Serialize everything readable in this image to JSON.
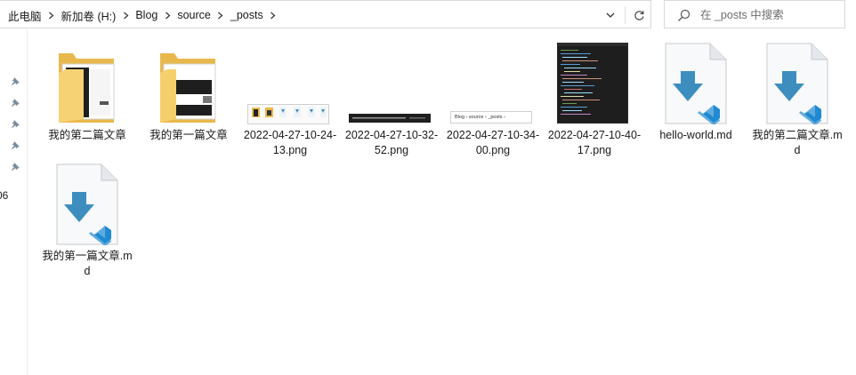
{
  "address": {
    "breadcrumb": [
      "此电脑",
      "新加卷 (H:)",
      "Blog",
      "source",
      "_posts"
    ]
  },
  "search": {
    "placeholder": "在 _posts 中搜索"
  },
  "nav": {
    "clipped_label": "06"
  },
  "files": [
    {
      "name": "我的第二篇文章",
      "type": "folder"
    },
    {
      "name": "我的第一篇文章",
      "type": "folder"
    },
    {
      "name": "2022-04-27-10-24-13.png",
      "type": "image"
    },
    {
      "name": "2022-04-27-10-32-52.png",
      "type": "image"
    },
    {
      "name": "2022-04-27-10-34-00.png",
      "type": "image",
      "thumb_text": "Blog  ›  source  ›  _posts  ›"
    },
    {
      "name": "2022-04-27-10-40-17.png",
      "type": "image"
    },
    {
      "name": "hello-world.md",
      "type": "markdown"
    },
    {
      "name": "我的第二篇文章.md",
      "type": "markdown"
    },
    {
      "name": "我的第一篇文章.md",
      "type": "markdown"
    }
  ],
  "colors": {
    "folder": "#f6cf6d",
    "md_arrow": "#3d8ebf",
    "vscode": "#1f8ad2"
  }
}
